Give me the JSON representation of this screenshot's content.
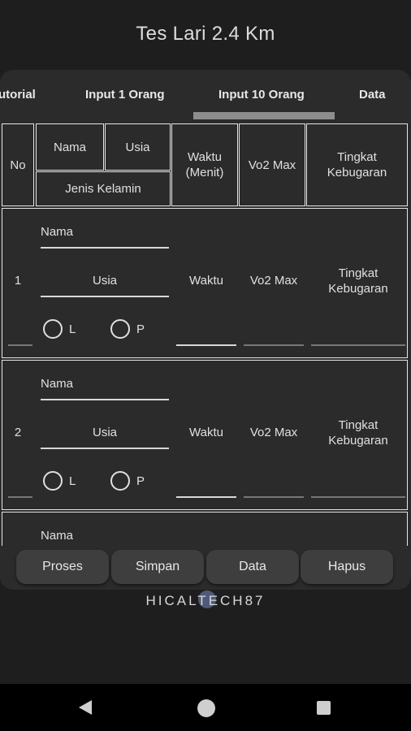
{
  "app": {
    "title": "Tes Lari 2.4 Km",
    "brand": "HICALTECH87"
  },
  "tabs": [
    "utorial",
    "Input 1 Orang",
    "Input 10 Orang",
    "Data"
  ],
  "active_tab_index": 2,
  "table_header": {
    "no": "No",
    "nama": "Nama",
    "usia": "Usia",
    "jenis_kelamin": "Jenis Kelamin",
    "waktu": "Waktu (Menit)",
    "vo2max": "Vo2 Max",
    "tingkat": "Tingkat Kebugaran"
  },
  "rows": [
    {
      "no": "1",
      "nama": "Nama",
      "usia": "Usia",
      "gender_l": "L",
      "gender_p": "P",
      "waktu": "Waktu",
      "vo2max": "Vo2 Max",
      "tingkat": "Tingkat Kebugaran"
    },
    {
      "no": "2",
      "nama": "Nama",
      "usia": "Usia",
      "gender_l": "L",
      "gender_p": "P",
      "waktu": "Waktu",
      "vo2max": "Vo2 Max",
      "tingkat": "Tingkat Kebugaran"
    },
    {
      "nama": "Nama"
    }
  ],
  "buttons": {
    "proses": "Proses",
    "simpan": "Simpan",
    "data": "Data",
    "hapus": "Hapus"
  },
  "colors": {
    "background": "#1e1e1e",
    "panel": "#2b2b2b",
    "button": "#3e3e3e",
    "text": "#e6e6e6"
  },
  "nav_icons": [
    "back-icon",
    "home-icon",
    "recent-apps-icon"
  ]
}
